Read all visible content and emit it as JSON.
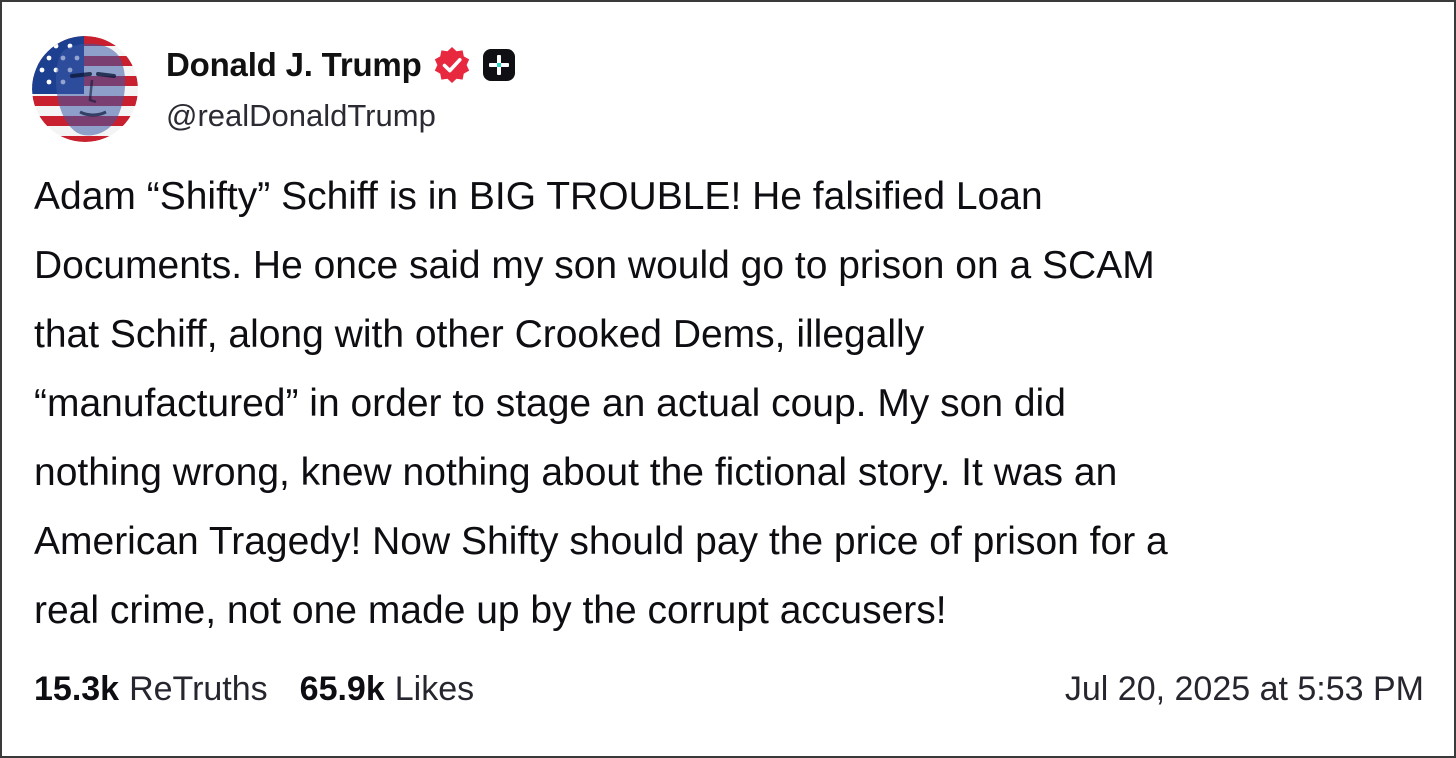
{
  "post": {
    "author": {
      "display_name": "Donald J. Trump",
      "handle": "@realDonaldTrump",
      "verified_icon": "verified-badge-icon",
      "plus_icon": "plus-badge-icon",
      "badge_color": "#e8283f"
    },
    "body_lines": [
      "Adam “Shifty” Schiff is in BIG TROUBLE! He falsified Loan",
      "Documents. He once said my son would go to prison on a SCAM",
      "that Schiff, along with other Crooked Dems, illegally",
      "“manufactured” in order to stage an actual coup. My son did",
      "nothing wrong, knew nothing about the fictional story. It was an",
      "American Tragedy! Now Shifty should pay the price of prison for a",
      "real crime, not one made up by the corrupt accusers!"
    ],
    "stats": {
      "retruths_count": "15.3k",
      "retruths_label": "ReTruths",
      "likes_count": "65.9k",
      "likes_label": "Likes"
    },
    "timestamp": "Jul 20, 2025 at 5:53 PM"
  }
}
